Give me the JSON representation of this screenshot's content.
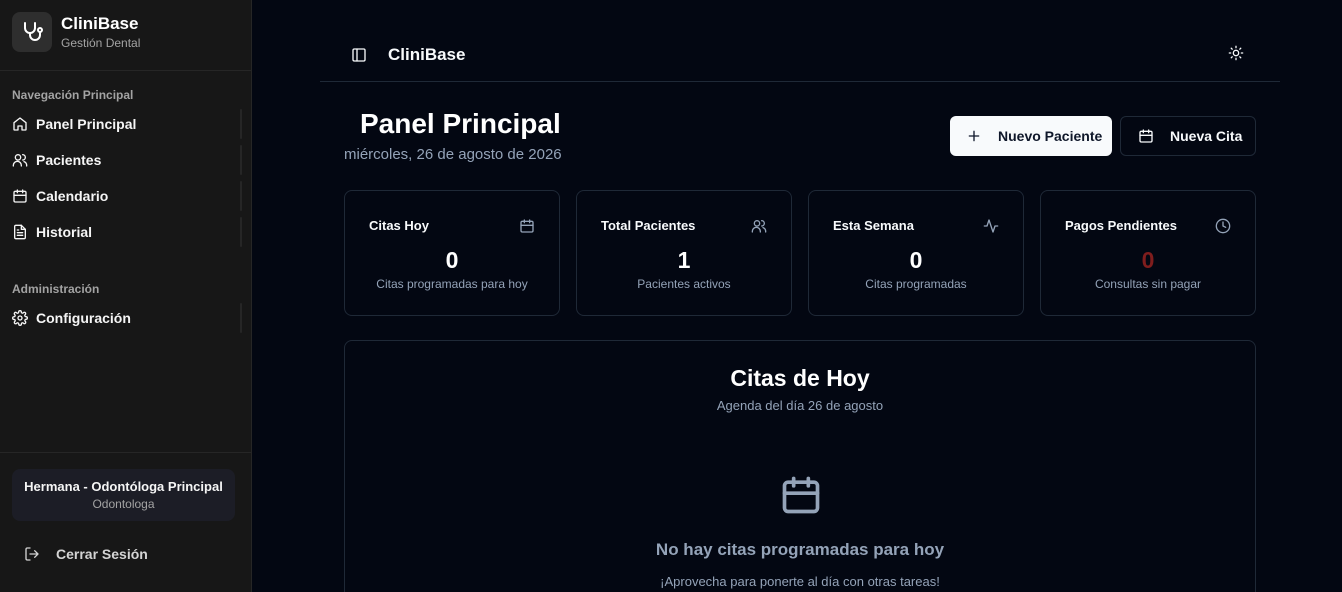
{
  "brand": {
    "name": "CliniBase",
    "subtitle": "Gestión Dental"
  },
  "sidebar": {
    "groups": [
      {
        "label": "Navegación Principal",
        "items": [
          {
            "label": "Panel Principal",
            "icon": "home-icon"
          },
          {
            "label": "Pacientes",
            "icon": "users-icon"
          },
          {
            "label": "Calendario",
            "icon": "calendar-icon"
          },
          {
            "label": "Historial",
            "icon": "file-text-icon"
          }
        ]
      },
      {
        "label": "Administración",
        "items": [
          {
            "label": "Configuración",
            "icon": "gear-icon"
          }
        ]
      }
    ],
    "user": {
      "name": "Hermana - Odontóloga Principal",
      "role": "Odontologa"
    },
    "logout_label": "Cerrar Sesión"
  },
  "topbar": {
    "title": "CliniBase"
  },
  "header": {
    "title": "Panel Principal",
    "date": "miércoles, 26 de agosto de 2026",
    "new_patient_label": "Nuevo Paciente",
    "new_appointment_label": "Nueva Cita"
  },
  "stats": [
    {
      "title": "Citas Hoy",
      "value": "0",
      "subtitle": "Citas programadas para hoy",
      "icon": "calendar-icon",
      "value_color": "#ffffff"
    },
    {
      "title": "Total Pacientes",
      "value": "1",
      "subtitle": "Pacientes activos",
      "icon": "users-icon",
      "value_color": "#ffffff"
    },
    {
      "title": "Esta Semana",
      "value": "0",
      "subtitle": "Citas programadas",
      "icon": "activity-icon",
      "value_color": "#ffffff"
    },
    {
      "title": "Pagos Pendientes",
      "value": "0",
      "subtitle": "Consultas sin pagar",
      "icon": "clock-icon",
      "value_color": "#7f1d1d"
    }
  ],
  "today": {
    "title": "Citas de Hoy",
    "subtitle": "Agenda del día 26 de agosto",
    "empty_title": "No hay citas programadas para hoy",
    "empty_subtitle": "¡Aprovecha para ponerte al día con otras tareas!"
  },
  "colors": {
    "background": "#030712",
    "sidebar": "#171717",
    "border": "#1f2937",
    "muted_text": "#94a3b8",
    "danger_value": "#7f1d1d"
  }
}
